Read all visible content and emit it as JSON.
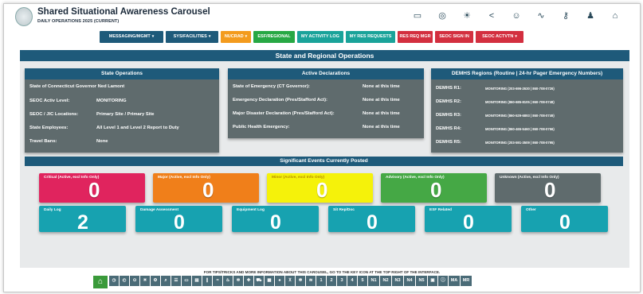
{
  "header": {
    "title": "Shared Situational Awareness Carousel",
    "subtitle": "DAILY OPERATIONS 2025 (CURRENT)",
    "icons": [
      "monitor-icon",
      "radar-icon",
      "sun-icon",
      "share-icon",
      "person-icon",
      "line-chart-icon",
      "key-icon",
      "users-icon",
      "home-icon"
    ]
  },
  "nav": [
    {
      "label": "MESSAGING/MGMT",
      "caret": "▾",
      "color": "#1e5a7a"
    },
    {
      "label": "SYS/FACILITIES",
      "caret": "▾",
      "color": "#1e5a7a"
    },
    {
      "label": "NUCRAD",
      "caret": "▾",
      "color": "#f39b1e"
    },
    {
      "label": "ESF/REGIONAL",
      "caret": "",
      "color": "#27a844"
    },
    {
      "label": "MY ACTIVITY LOG",
      "caret": "",
      "color": "#1aa39a"
    },
    {
      "label": "MY RES REQUESTS",
      "caret": "",
      "color": "#1aa39a"
    },
    {
      "label": "RES REQ MGR",
      "caret": "",
      "color": "#d32f3f"
    },
    {
      "label": "SEOC SIGN IN",
      "caret": "",
      "color": "#d32f3f"
    },
    {
      "label": "SEOC ACTVTN",
      "caret": "▾",
      "color": "#d32f3f"
    }
  ],
  "main_title": "State and Regional Operations",
  "state_ops": {
    "title": "State Operations",
    "governor": "State of Connecticut Governor Ned Lamont",
    "rows": [
      {
        "label": "SEOC Activ Level:",
        "value": "MONITORING"
      },
      {
        "label": "SEOC / JIC Locations:",
        "value": "Primary Site   / Primary Site"
      },
      {
        "label": "State Employees:",
        "value": "All Level 1 and Level 2 Report to Duty"
      },
      {
        "label": "Travel Bans:",
        "value": "None"
      }
    ]
  },
  "declarations": {
    "title": "Active Declarations",
    "rows": [
      {
        "label": "State of Emergency (CT Governor):",
        "value": "None at this time"
      },
      {
        "label": "Emergency Declaration (Pres/Stafford Act):",
        "value": "None at this time"
      },
      {
        "label": "Major Disaster Declaration (Pres/Stafford Act):",
        "value": "None at this time"
      },
      {
        "label": "Public Health Emergency:",
        "value": "None at this time"
      }
    ]
  },
  "regions": {
    "title": "DEMHS Regions (Routine | 24-hr Pager Emergency Numbers)",
    "rows": [
      {
        "label": "DEMHS R1:",
        "value": "MONITORING   (203-696-2630 | 860-708-0726)"
      },
      {
        "label": "DEMHS R2:",
        "value": "MONITORING   (860-685-8105 | 860-708-0748)"
      },
      {
        "label": "DEMHS R3:",
        "value": "MONITORING   (860-529-6893 | 860-708-0749)"
      },
      {
        "label": "DEMHS R4:",
        "value": "MONITORING   (860-465-5460 | 860-708-0756)"
      },
      {
        "label": "DEMHS R5:",
        "value": "MONITORING   (203-591-3509 | 860-708-0795)"
      }
    ]
  },
  "events": {
    "title": "Significant Events Currently Posted",
    "row1": [
      {
        "label": "Critical (Active, excl Info Only)",
        "value": "0",
        "color": "#e0245e"
      },
      {
        "label": "Major (Active, excl Info Only)",
        "value": "0",
        "color": "#f07f1a"
      },
      {
        "label": "Minor (Active, excl Info Only)",
        "value": "0",
        "color": "#f5f20a"
      },
      {
        "label": "Advisory (Active, excl Info Only)",
        "value": "0",
        "color": "#45a845"
      },
      {
        "label": "Unknown (Active, excl Info Only)",
        "value": "0",
        "color": "#5f6b6d"
      }
    ],
    "row2": [
      {
        "label": "Daily Log",
        "value": "2",
        "color": "#17a2b0"
      },
      {
        "label": "Damage Assessment",
        "value": "0",
        "color": "#17a2b0"
      },
      {
        "label": "Equipment Log",
        "value": "0",
        "color": "#17a2b0"
      },
      {
        "label": "Sit Rep/Doc",
        "value": "0",
        "color": "#17a2b0"
      },
      {
        "label": "ESF Related",
        "value": "0",
        "color": "#17a2b0"
      },
      {
        "label": "Other",
        "value": "0",
        "color": "#17a2b0"
      }
    ]
  },
  "footer": {
    "note": "FOR TIPS/TRICKS AND MORE INFORMATION ABOUT THIS CAROUSEL, GO TO THE KEY ICON AT THE TOP RIGHT OF THE INTERFACE.",
    "home_icon": "⌂",
    "icon_buttons": [
      "alarm-icon",
      "clock-icon",
      "pin-icon",
      "sun-icon",
      "gear-icon",
      "search-icon",
      "list-icon",
      "monitor-icon",
      "chart-icon",
      "road-icon",
      "flood-icon",
      "fire-icon",
      "virus-icon",
      "hospital-icon",
      "truck-icon",
      "building-icon",
      "flame-icon",
      "tower-icon",
      "snow-icon",
      "wind-icon"
    ],
    "text_buttons": [
      "1",
      "2",
      "3",
      "4",
      "5",
      "N1",
      "N2",
      "N3",
      "N4",
      "N5"
    ],
    "extra_buttons": [
      {
        "name": "media-icon",
        "glyph": "▣"
      },
      {
        "name": "info-icon",
        "glyph": "ⓘ"
      }
    ],
    "tail_buttons": [
      "MA",
      "MR"
    ]
  }
}
